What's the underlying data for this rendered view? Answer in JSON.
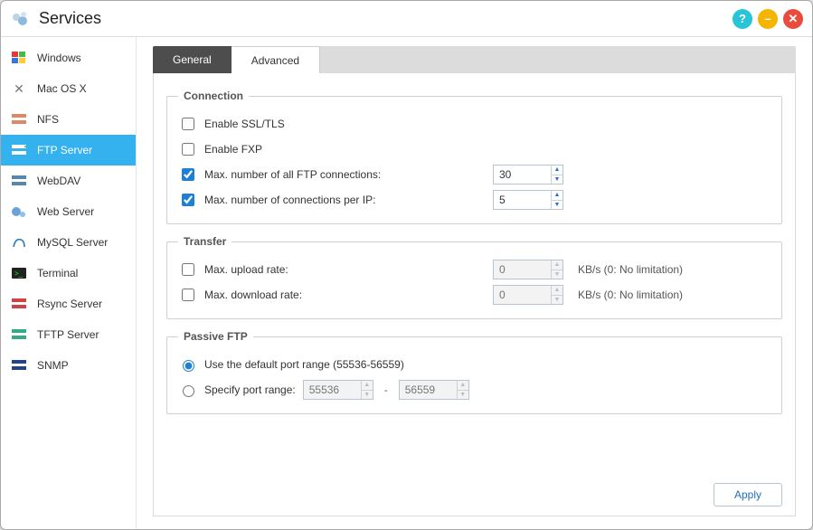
{
  "window": {
    "title": "Services"
  },
  "sidebar": {
    "items": [
      {
        "label": "Windows",
        "icon": "windows"
      },
      {
        "label": "Mac OS X",
        "icon": "mac"
      },
      {
        "label": "NFS",
        "icon": "nfs"
      },
      {
        "label": "FTP Server",
        "icon": "ftp",
        "active": true
      },
      {
        "label": "WebDAV",
        "icon": "webdav"
      },
      {
        "label": "Web Server",
        "icon": "webserver"
      },
      {
        "label": "MySQL Server",
        "icon": "mysql"
      },
      {
        "label": "Terminal",
        "icon": "terminal"
      },
      {
        "label": "Rsync Server",
        "icon": "rsync"
      },
      {
        "label": "TFTP Server",
        "icon": "tftp"
      },
      {
        "label": "SNMP",
        "icon": "snmp"
      }
    ]
  },
  "tabs": {
    "general": "General",
    "advanced": "Advanced",
    "active": "advanced"
  },
  "groups": {
    "connection": {
      "legend": "Connection",
      "enable_ssl": {
        "label": "Enable SSL/TLS",
        "checked": false
      },
      "enable_fxp": {
        "label": "Enable FXP",
        "checked": false
      },
      "max_all": {
        "label": "Max. number of all FTP connections:",
        "checked": true,
        "value": "30"
      },
      "max_per_ip": {
        "label": "Max. number of connections per IP:",
        "checked": true,
        "value": "5"
      }
    },
    "transfer": {
      "legend": "Transfer",
      "upload": {
        "label": "Max. upload rate:",
        "checked": false,
        "value": "0",
        "suffix": "KB/s (0: No limitation)"
      },
      "download": {
        "label": "Max. download rate:",
        "checked": false,
        "value": "0",
        "suffix": "KB/s (0: No limitation)"
      }
    },
    "passive": {
      "legend": "Passive FTP",
      "default_opt": {
        "label": "Use the default port range (55536-56559)",
        "selected": true
      },
      "specify_opt": {
        "label": "Specify port range:",
        "selected": false,
        "from": "55536",
        "to": "56559"
      }
    }
  },
  "buttons": {
    "apply": "Apply"
  }
}
